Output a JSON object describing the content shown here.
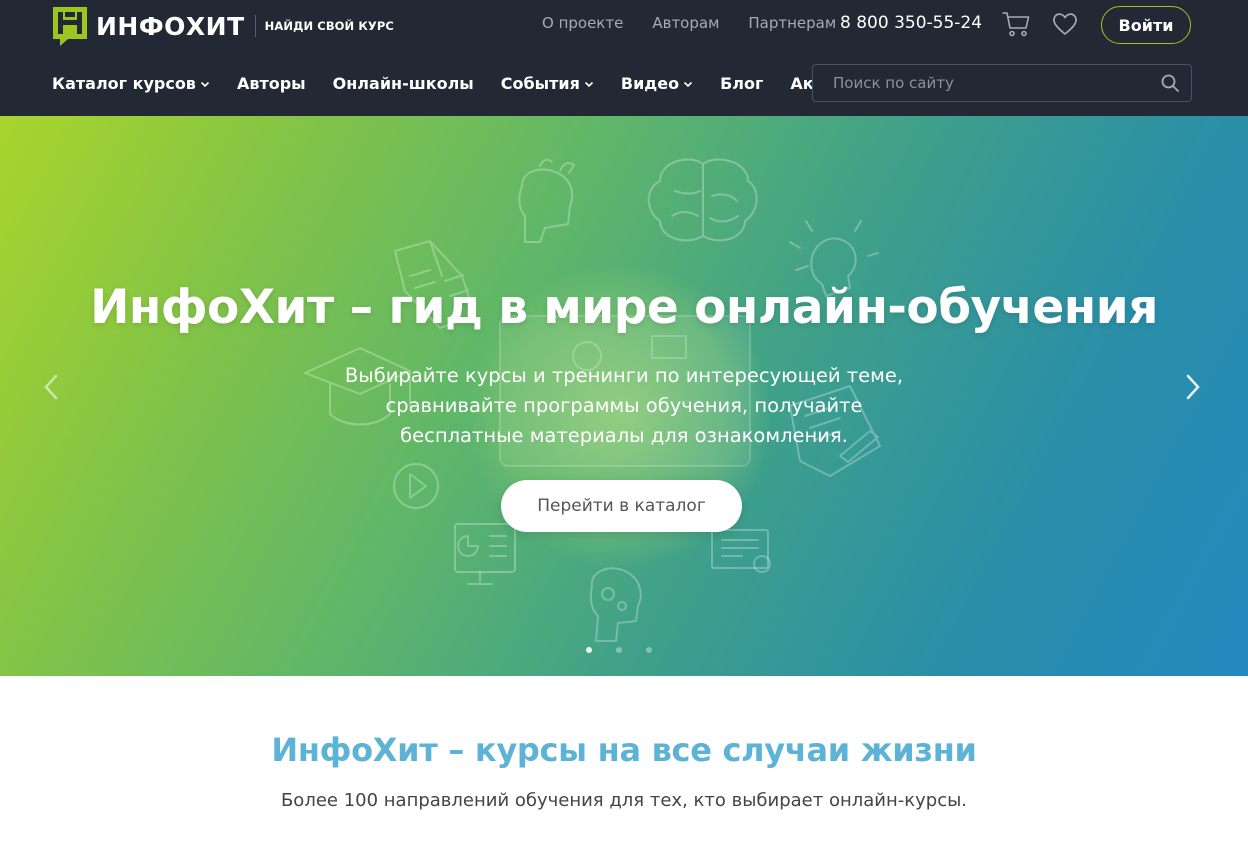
{
  "header": {
    "logo_text": "ИНФОХИТ",
    "slogan": "НАЙДИ СВОЙ КУРС",
    "top_links": [
      "О проекте",
      "Авторам",
      "Партнерам"
    ],
    "phone": "8 800 350-55-24",
    "login_label": "Войти",
    "cart_icon": "cart-icon",
    "favorites_icon": "heart-icon"
  },
  "nav": {
    "items": [
      {
        "label": "Каталог курсов",
        "dropdown": true
      },
      {
        "label": "Авторы",
        "dropdown": false
      },
      {
        "label": "Онлайн-школы",
        "dropdown": false
      },
      {
        "label": "События",
        "dropdown": true
      },
      {
        "label": "Видео",
        "dropdown": true
      },
      {
        "label": "Блог",
        "dropdown": false
      },
      {
        "label": "Акции",
        "dropdown": false
      }
    ],
    "search_placeholder": "Поиск по сайту"
  },
  "hero": {
    "title": "ИнфоХит – гид в мире онлайн-обучения",
    "subtitle_lines": [
      "Выбирайте курсы и тренинги по интересующей теме,",
      "сравнивайте программы обучения, получайте",
      "бесплатные материалы для ознакомления."
    ],
    "cta_label": "Перейти в каталог",
    "slides_count": 3,
    "active_slide": 1
  },
  "intro": {
    "title": "ИнфоХит – курсы на все случаи жизни",
    "subtitle": "Более 100 направлений обучения для тех, кто выбирает онлайн-курсы."
  },
  "colors": {
    "header_bg": "#222834",
    "accent_green": "#9bc520",
    "intro_title": "#5db3d6"
  }
}
